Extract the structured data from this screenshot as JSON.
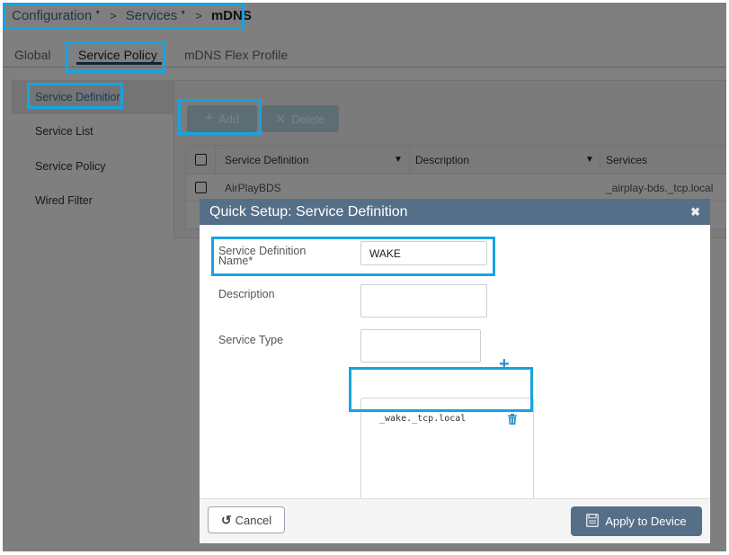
{
  "breadcrumb": {
    "items": [
      {
        "label": "Configuration",
        "has_dropdown": true
      },
      {
        "label": "Services",
        "has_dropdown": true
      }
    ],
    "current": "mDNS",
    "separator": ">"
  },
  "tabs": [
    {
      "label": "Global",
      "active": false
    },
    {
      "label": "Service Policy",
      "active": true
    },
    {
      "label": "mDNS Flex Profile",
      "active": false
    }
  ],
  "sidebar": {
    "items": [
      {
        "label": "Service Definition",
        "active": true
      },
      {
        "label": "Service List",
        "active": false
      },
      {
        "label": "Service Policy",
        "active": false
      },
      {
        "label": "Wired Filter",
        "active": false
      }
    ]
  },
  "toolbar": {
    "add_label": "Add",
    "delete_label": "Delete",
    "add_icon": "plus-icon",
    "delete_icon": "x-icon"
  },
  "table": {
    "columns": [
      "Service Definition",
      "Description",
      "Services"
    ],
    "rows": [
      {
        "service_definition": "AirPlayBDS",
        "description": "",
        "services": "_airplay-bds._tcp.local"
      }
    ]
  },
  "modal": {
    "title": "Quick Setup: Service Definition",
    "close_icon": "close-icon",
    "fields": {
      "name_label": "Service Definition Name*",
      "name_label_line1": "Service Definition",
      "name_label_line2": "Name*",
      "name_value": "WAKE",
      "description_label": "Description",
      "description_value": "",
      "service_type_label": "Service Type",
      "service_type_value": ""
    },
    "add_service_icon": "plus-icon",
    "service_types": [
      "_wake._tcp.local"
    ],
    "cancel_label": "Cancel",
    "apply_label": "Apply to Device"
  },
  "colors": {
    "highlight": "#17a3e0",
    "modal_header": "#566f88",
    "accent_link": "#2a7ab8",
    "plus_icon": "#2a8ec8"
  }
}
